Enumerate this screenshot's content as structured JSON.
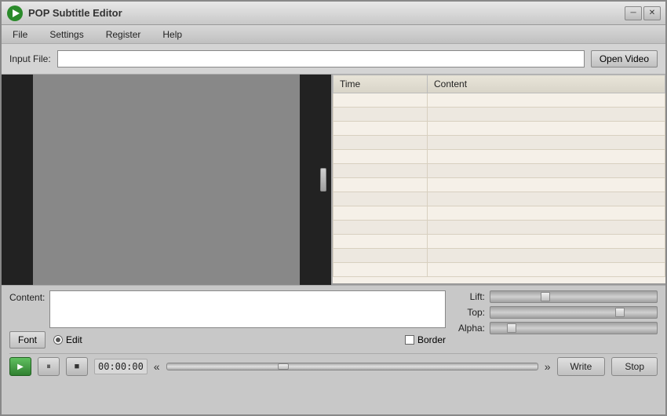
{
  "titleBar": {
    "appName": "POP  Subtitle Editor",
    "minimizeLabel": "─",
    "closeLabel": "✕"
  },
  "menuBar": {
    "items": [
      "File",
      "Settings",
      "Register",
      "Help"
    ]
  },
  "inputFile": {
    "label": "Input File:",
    "placeholder": "",
    "openVideoLabel": "Open Video"
  },
  "subtitleTable": {
    "columns": [
      "Time",
      "Content"
    ],
    "rows": []
  },
  "bottomControls": {
    "contentLabel": "Content:",
    "fontLabel": "Font",
    "editLabel": "Edit",
    "borderLabel": "Border",
    "sliders": [
      {
        "label": "Lift:",
        "thumbPos": "30%"
      },
      {
        "label": "Top:",
        "thumbPos": "75%"
      },
      {
        "label": "Alpha:",
        "thumbPos": "10%"
      }
    ],
    "writeLabel": "Write",
    "stopLabel": "Stop"
  },
  "playback": {
    "timeDisplay": "00:00:00",
    "playIcon": "▶",
    "pauseIcon": "⏸",
    "stopIcon": "■",
    "seekBackIcon": "«",
    "seekFwdIcon": "»"
  }
}
